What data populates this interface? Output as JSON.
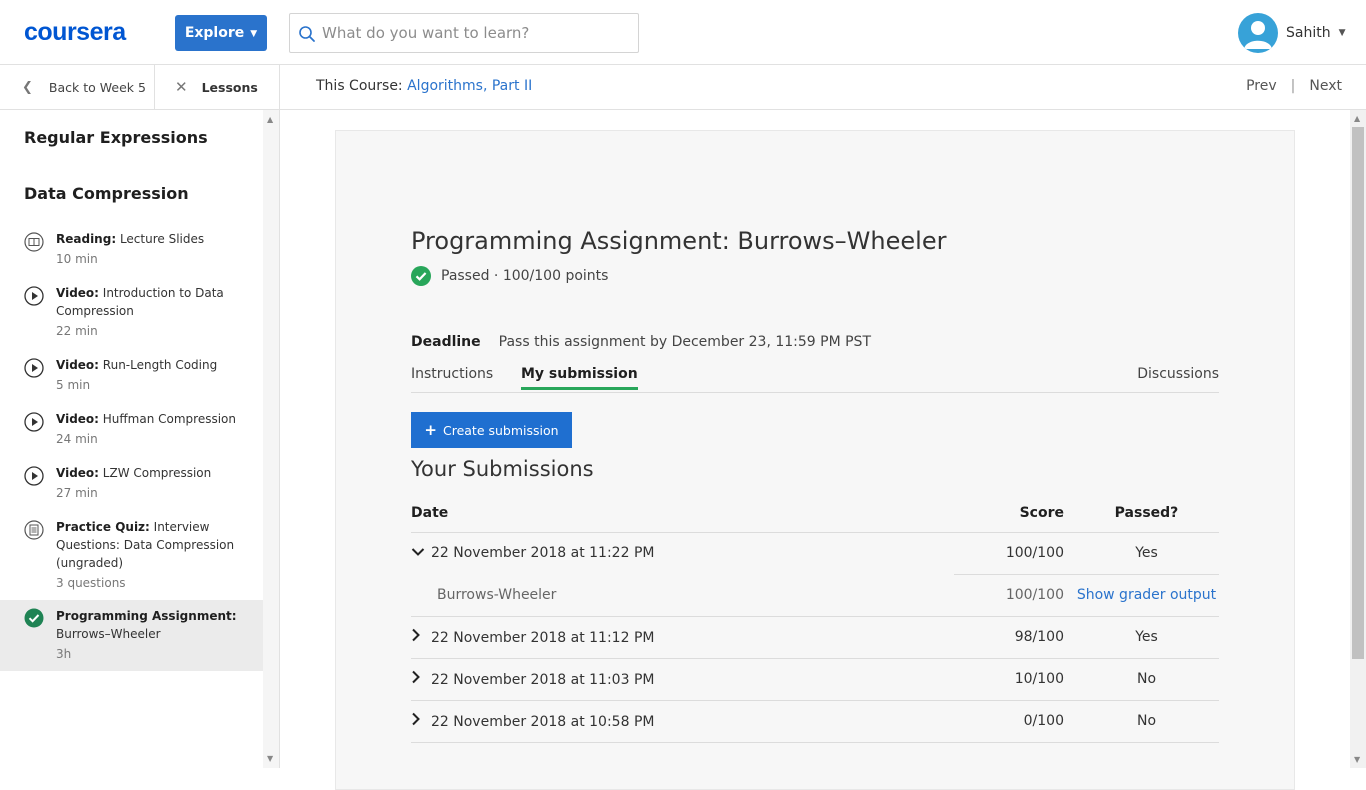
{
  "header": {
    "logo_text": "coursera",
    "explore_label": "Explore",
    "search_placeholder": "What do you want to learn?",
    "user_name": "Sahith"
  },
  "subbar": {
    "back_label": "Back to Week 5",
    "lessons_label": "Lessons",
    "course_prefix": "This Course: ",
    "course_name": "Algorithms, Part II",
    "prev_label": "Prev",
    "sep": "|",
    "next_label": "Next"
  },
  "sidebar": {
    "sections": [
      "Regular Expressions",
      "Data Compression"
    ],
    "items": [
      {
        "type": "Reading:",
        "title": " Lecture Slides",
        "duration": "10 min",
        "icon": "book-icon"
      },
      {
        "type": "Video:",
        "title": " Introduction to Data Compression",
        "duration": "22 min",
        "icon": "play-icon"
      },
      {
        "type": "Video:",
        "title": " Run-Length Coding",
        "duration": "5 min",
        "icon": "play-icon"
      },
      {
        "type": "Video:",
        "title": " Huffman Compression",
        "duration": "24 min",
        "icon": "play-icon"
      },
      {
        "type": "Video:",
        "title": " LZW Compression",
        "duration": "27 min",
        "icon": "play-icon"
      },
      {
        "type": "Practice Quiz:",
        "title": " Interview Questions: Data Compression (ungraded)",
        "duration": "3 questions",
        "icon": "quiz-icon"
      },
      {
        "type": "Programming Assignment:",
        "title": " Burrows–Wheeler",
        "duration": "3h",
        "icon": "completed-check-icon"
      }
    ]
  },
  "assignment": {
    "title": "Programming Assignment: Burrows–Wheeler",
    "status": "Passed · 100/100 points",
    "deadline_label": "Deadline",
    "deadline_text": "Pass this assignment by December 23, 11:59 PM PST",
    "tabs": [
      "Instructions",
      "My submission",
      "Discussions"
    ],
    "create_label": "Create submission",
    "submissions_heading": "Your Submissions"
  },
  "submissions": {
    "headers": {
      "date": "Date",
      "score": "Score",
      "passed": "Passed?"
    },
    "rows": [
      {
        "date": "22 November 2018 at 11:22 PM",
        "score": "100/100",
        "passed": "Yes",
        "toggle": "⌄"
      },
      {
        "part": "Burrows-Wheeler",
        "score": "100/100",
        "link": "Show grader output"
      },
      {
        "date": "22 November 2018 at 11:12 PM",
        "score": "98/100",
        "passed": "Yes",
        "toggle": "›"
      },
      {
        "date": "22 November 2018 at 11:03 PM",
        "score": "10/100",
        "passed": "No",
        "toggle": "›"
      },
      {
        "date": "22 November 2018 at 10:58 PM",
        "score": "0/100",
        "passed": "No",
        "toggle": "›"
      }
    ]
  },
  "colors": {
    "brand": "#0056d2",
    "button": "#1f6fd0",
    "success": "#28a65a",
    "link": "#2a73cc"
  }
}
